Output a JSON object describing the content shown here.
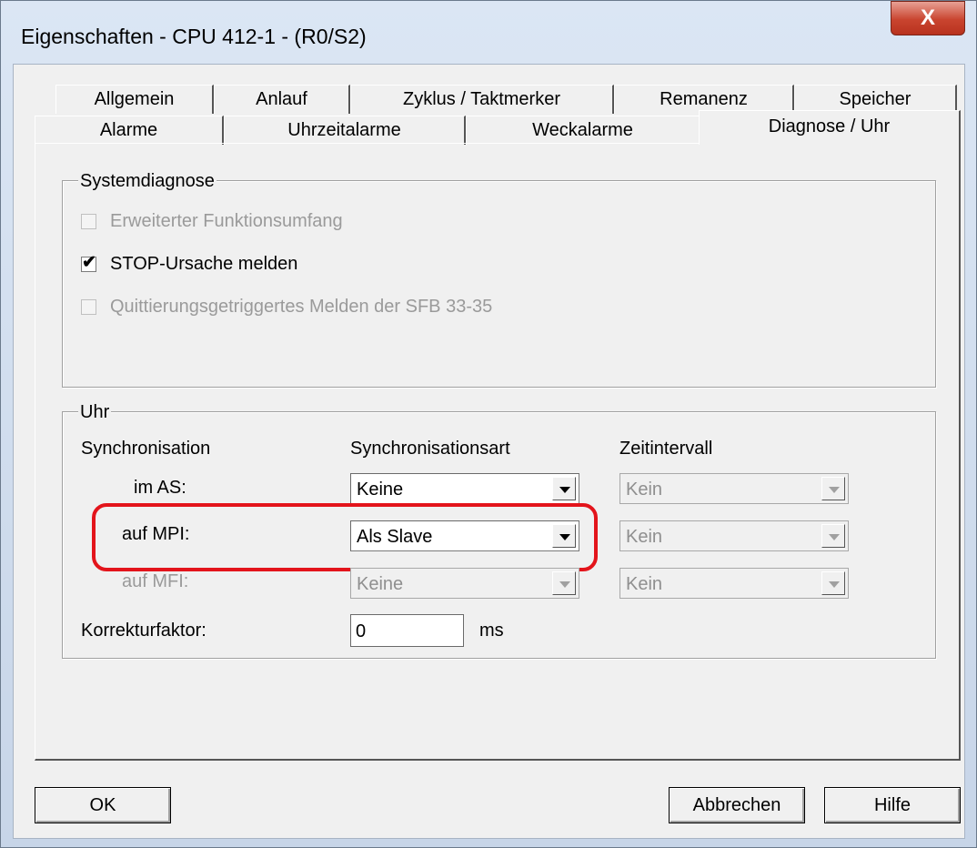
{
  "window": {
    "title": "Eigenschaften - CPU 412-1 - (R0/S2)",
    "close_label": "X"
  },
  "tabs": {
    "row1": [
      "Allgemein",
      "Anlauf",
      "Zyklus / Taktmerker",
      "Remanenz",
      "Speicher"
    ],
    "row2": [
      "Alarme",
      "Uhrzeitalarme",
      "Weckalarme",
      "Diagnose / Uhr"
    ],
    "active": "Diagnose / Uhr"
  },
  "systemdiagnose": {
    "legend": "Systemdiagnose",
    "options": [
      {
        "label": "Erweiterter Funktionsumfang",
        "checked": false,
        "enabled": false
      },
      {
        "label": "STOP-Ursache melden",
        "checked": true,
        "enabled": true
      },
      {
        "label": "Quittierungsgetriggertes Melden der SFB 33-35",
        "checked": false,
        "enabled": false
      }
    ]
  },
  "uhr": {
    "legend": "Uhr",
    "col_sync": "Synchronisation",
    "col_art": "Synchronisationsart",
    "col_interval": "Zeitintervall",
    "rows": [
      {
        "label": "im AS:",
        "art": "Keine",
        "interval": "Kein"
      },
      {
        "label": "auf MPI:",
        "art": "Als Slave",
        "interval": "Kein"
      },
      {
        "label": "auf MFI:",
        "art": "Keine",
        "interval": "Kein"
      }
    ],
    "korrektur_label": "Korrekturfaktor:",
    "korrektur_value": "0",
    "korrektur_unit": "ms"
  },
  "buttons": {
    "ok": "OK",
    "cancel": "Abbrechen",
    "help": "Hilfe"
  },
  "colors": {
    "highlight": "#e3141b",
    "close": "#c9442f"
  }
}
